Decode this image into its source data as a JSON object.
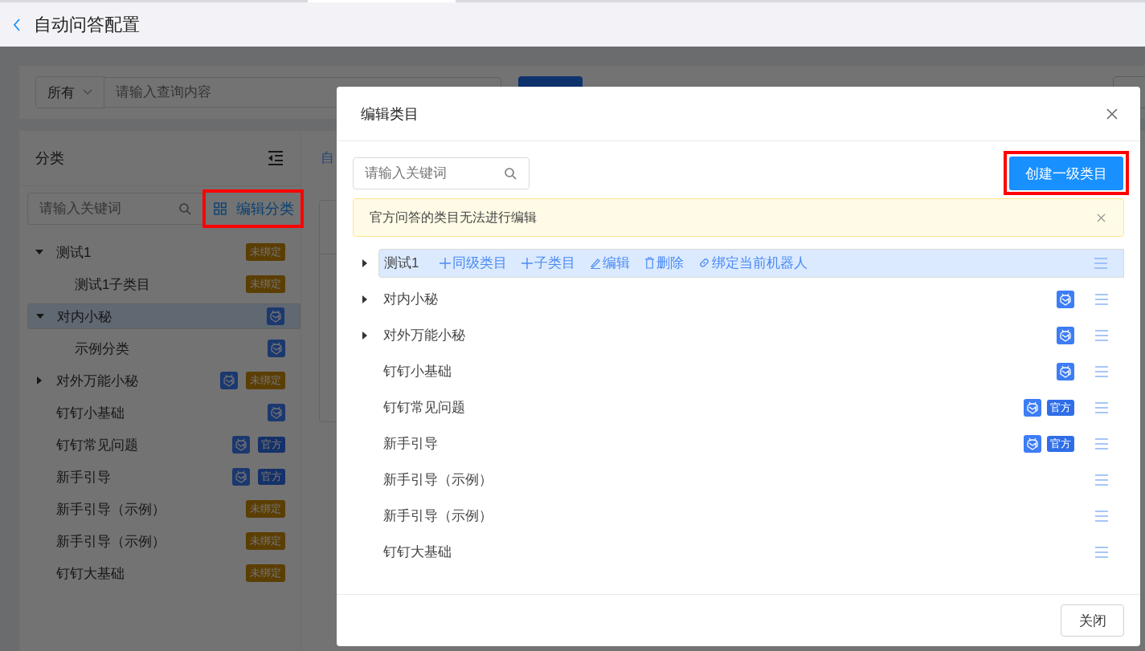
{
  "header": {
    "title": "自动问答配置"
  },
  "filter": {
    "scope": "所有",
    "placeholder": "请输入查询内容"
  },
  "sidebar": {
    "title": "分类",
    "search": {
      "placeholder": "请输入关键词"
    },
    "edit_button": {
      "label": "编辑分类",
      "highlighted": true
    },
    "tree": [
      {
        "label": "测试1",
        "kind": "group",
        "expanded": true,
        "selected": false,
        "badges": [
          {
            "kind": "unbound",
            "text": "未绑定"
          }
        ],
        "children": [
          {
            "label": "测试1子类目",
            "selected": false,
            "badges": [
              {
                "kind": "unbound",
                "text": "未绑定"
              }
            ]
          }
        ]
      },
      {
        "label": "对内小秘",
        "kind": "group",
        "expanded": true,
        "selected": true,
        "badges": [
          {
            "kind": "robot"
          }
        ],
        "children": [
          {
            "label": "示例分类",
            "selected": false,
            "badges": [
              {
                "kind": "robot"
              }
            ]
          }
        ]
      },
      {
        "label": "对外万能小秘",
        "kind": "group",
        "expanded": false,
        "selected": false,
        "badges": [
          {
            "kind": "robot"
          },
          {
            "kind": "unbound",
            "text": "未绑定"
          }
        ]
      },
      {
        "label": "钉钉小基础",
        "kind": "leaf",
        "selected": false,
        "badges": [
          {
            "kind": "robot"
          }
        ]
      },
      {
        "label": "钉钉常见问题",
        "kind": "leaf",
        "selected": false,
        "badges": [
          {
            "kind": "robot"
          },
          {
            "kind": "official",
            "text": "官方"
          }
        ]
      },
      {
        "label": "新手引导",
        "kind": "leaf",
        "selected": false,
        "badges": [
          {
            "kind": "robot"
          },
          {
            "kind": "official",
            "text": "官方"
          }
        ]
      },
      {
        "label": "新手引导（示例）",
        "kind": "leaf",
        "selected": false,
        "badges": [
          {
            "kind": "unbound",
            "text": "未绑定"
          }
        ]
      },
      {
        "label": "新手引导（示例）",
        "kind": "leaf",
        "selected": false,
        "badges": [
          {
            "kind": "unbound",
            "text": "未绑定"
          }
        ]
      },
      {
        "label": "钉钉大基础",
        "kind": "leaf",
        "selected": false,
        "badges": [
          {
            "kind": "unbound",
            "text": "未绑定"
          }
        ]
      }
    ]
  },
  "main": {
    "tab_fragment": "自"
  },
  "dialog": {
    "title": "编辑类目",
    "search": {
      "placeholder": "请输入关键词"
    },
    "create_button": {
      "label": "创建一级类目",
      "highlighted": true
    },
    "alert": {
      "text": "官方问答的类目无法进行编辑"
    },
    "rows": [
      {
        "label": "测试1",
        "kind": "group",
        "expanded": false,
        "selected": true,
        "badges": [],
        "actions": [
          {
            "kind": "add",
            "label": "同级类目"
          },
          {
            "kind": "add",
            "label": "子类目"
          },
          {
            "kind": "edit",
            "label": "编辑"
          },
          {
            "kind": "delete",
            "label": "删除"
          },
          {
            "kind": "link",
            "label": "绑定当前机器人"
          }
        ]
      },
      {
        "label": "对内小秘",
        "kind": "group",
        "expanded": false,
        "selected": false,
        "badges": [
          {
            "kind": "robot"
          }
        ]
      },
      {
        "label": "对外万能小秘",
        "kind": "group",
        "expanded": false,
        "selected": false,
        "badges": [
          {
            "kind": "robot"
          }
        ]
      },
      {
        "label": "钉钉小基础",
        "kind": "leaf",
        "selected": false,
        "badges": [
          {
            "kind": "robot"
          }
        ]
      },
      {
        "label": "钉钉常见问题",
        "kind": "leaf",
        "selected": false,
        "badges": [
          {
            "kind": "robot"
          },
          {
            "kind": "official",
            "text": "官方"
          }
        ]
      },
      {
        "label": "新手引导",
        "kind": "leaf",
        "selected": false,
        "badges": [
          {
            "kind": "robot"
          },
          {
            "kind": "official",
            "text": "官方"
          }
        ]
      },
      {
        "label": "新手引导（示例）",
        "kind": "leaf",
        "selected": false
      },
      {
        "label": "新手引导（示例）",
        "kind": "leaf",
        "selected": false
      },
      {
        "label": "钉钉大基础",
        "kind": "leaf",
        "selected": false
      }
    ],
    "close_button": "关闭"
  }
}
